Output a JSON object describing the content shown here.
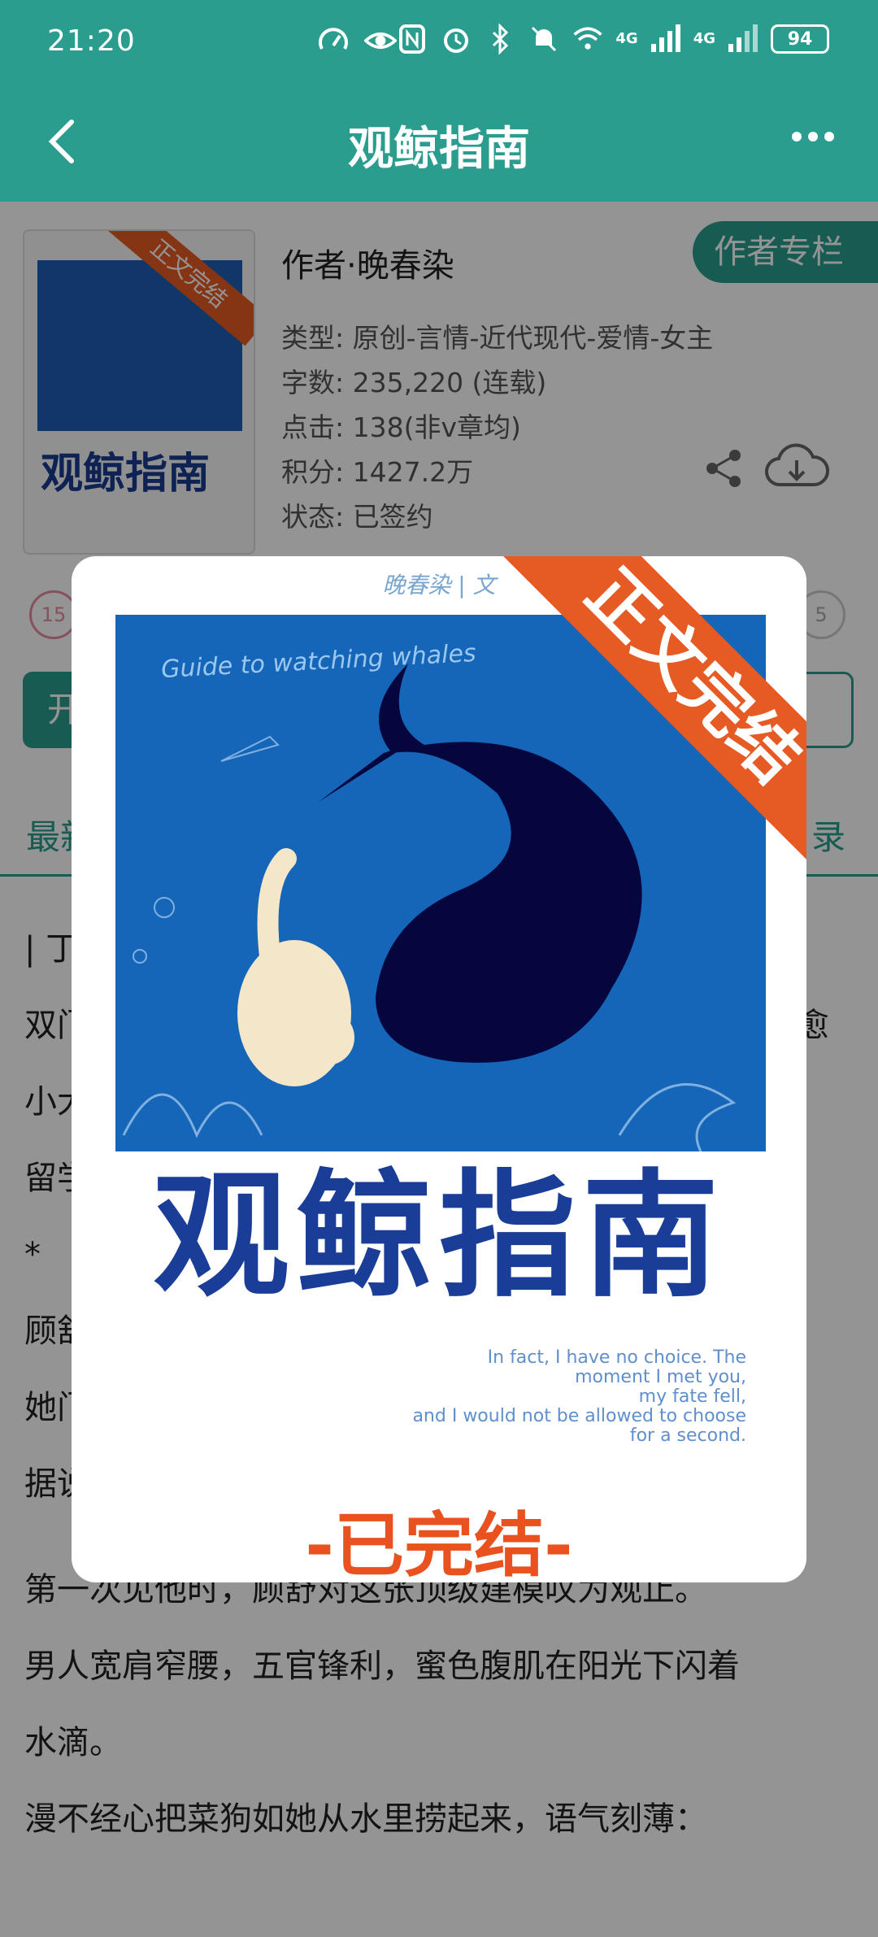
{
  "status_bar": {
    "time": "21:20",
    "battery": "94",
    "net1": "4G",
    "net2": "4G"
  },
  "header": {
    "title": "观鲸指南"
  },
  "book": {
    "author_line": "作者·晚春染",
    "author_column_button": "作者专栏",
    "meta": [
      "类型: 原创-言情-近代现代-爱情-女主",
      "字数: 235,220 (连载)",
      "点击: 138(非v章均)",
      "积分: 1427.2万",
      "状态: 已签约"
    ],
    "thumb_title": "观鲸指南",
    "thumb_band": "正文完结",
    "left_badge": "15",
    "right_badge": "5"
  },
  "buttons": {
    "start_read": "开"
  },
  "tabs": {
    "latest": "最新",
    "catalog": "录"
  },
  "body": {
    "partial_lines": [
      "| 丁",
      "双门",
      "小大",
      "留学",
      "  *",
      "顾舒",
      "她门",
      "据说"
    ],
    "partial_right": "愈",
    "full_lines": [
      "第一次见他时，顾舒对这张顶级建模叹为观止。",
      "男人宽肩窄腰，五官锋利，蜜色腹肌在阳光下闪着",
      "水滴。",
      "漫不经心把菜狗如她从水里捞起来，语气刻薄："
    ]
  },
  "popup": {
    "author": "晚春染 | 文",
    "tagline": "Guide to watching whales",
    "band": "正文完结",
    "title": "观鲸指南",
    "quote": [
      "In fact, I have no choice. The",
      "moment I met you,",
      "my fate fell,",
      "and I would not be allowed to choose",
      "for a second."
    ],
    "done": "-已完结-"
  }
}
